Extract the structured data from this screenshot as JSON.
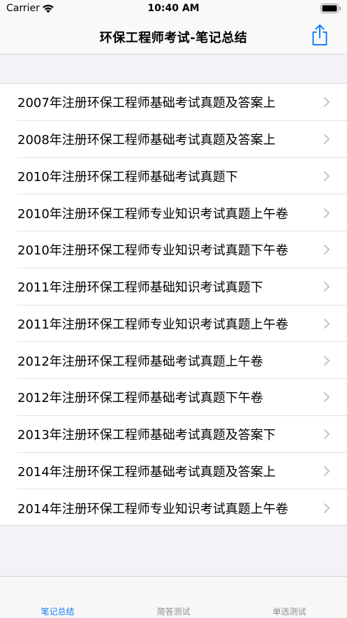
{
  "status_bar": {
    "carrier": "Carrier",
    "time": "10:40 AM"
  },
  "nav": {
    "title": "环保工程师考试-笔记总结",
    "share_icon": "share-icon",
    "accent_color": "#147efb"
  },
  "list": {
    "items": [
      {
        "label": "2007年注册环保工程师基础考试真题及答案上"
      },
      {
        "label": "2008年注册环保工程师基础考试真题及答案上"
      },
      {
        "label": "2010年注册环保工程师基础考试真题下"
      },
      {
        "label": "2010年注册环保工程师专业知识考试真题上午卷"
      },
      {
        "label": "2010年注册环保工程师专业知识考试真题下午卷"
      },
      {
        "label": "2011年注册环保工程师基础知识考试真题下"
      },
      {
        "label": "2011年注册环保工程师专业知识考试真题上午卷"
      },
      {
        "label": "2012年注册环保工程师基础考试真题上午卷"
      },
      {
        "label": "2012年注册环保工程师基础考试真题下午卷"
      },
      {
        "label": "2013年注册环保工程师基础考试真题及答案下"
      },
      {
        "label": "2014年注册环保工程师基础考试真题及答案上"
      },
      {
        "label": "2014年注册环保工程师专业知识考试真题上午卷"
      }
    ]
  },
  "tab_bar": {
    "tabs": [
      {
        "label": "笔记总结",
        "active": true
      },
      {
        "label": "简答测试",
        "active": false
      },
      {
        "label": "单选测试",
        "active": false
      }
    ]
  }
}
